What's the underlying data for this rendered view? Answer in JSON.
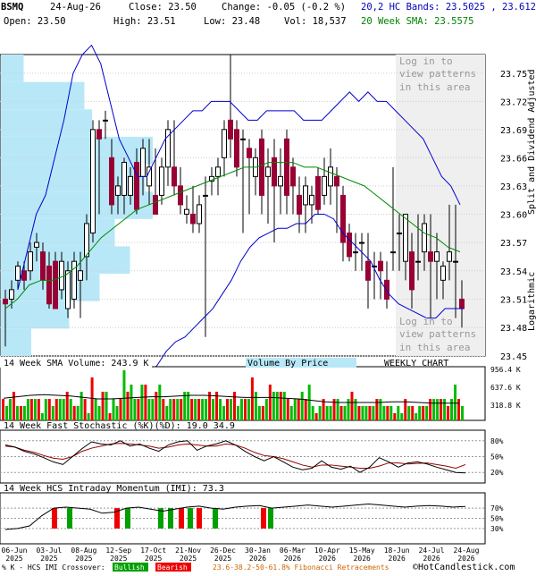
{
  "header": {
    "symbol": "BSMQ",
    "date": "24-Aug-26",
    "close": "Close: 23.50",
    "change": "Change: -0.05 (-0.2 %)",
    "open": "Open: 23.50",
    "high": "High: 23.51",
    "low": "Low: 23.48",
    "vol": "Vol: 18,537",
    "bands": "20,2 HC Bands: 23.5025 , 23.6126",
    "sma": "20 Week SMA: 23.5575"
  },
  "labels": {
    "side_adjusted": "Split and Dividend Adjusted",
    "side_log": "Logarithmic",
    "login_top": [
      "Log in to",
      "view patterns",
      "in this area"
    ],
    "login_bottom": [
      "Log in to",
      "view patterns",
      "in this area"
    ],
    "volume_title": "14 Week SMA Volume: 243.9 K",
    "vbp": "Volume By Price",
    "weekly": "WEEKLY CHART",
    "stoch_title": "14 Week Fast Stochastic (%K)(%D): 19.0  34.9",
    "imi_title": "14 Week HCS Intraday Momentum (IMI): 73.3",
    "footer_left": "% K - HCS IMI Crossover:",
    "bullish": "Bullish",
    "bearish": "Bearish",
    "fib": "23.6-38.2-50-61.8% Fibonacci Retracements",
    "copyright": "©HotCandlestick.com"
  },
  "colors": {
    "up": "#00a000",
    "down": "#990033",
    "bands": "#0000cc",
    "sma": "#008800",
    "vbp": "#b8e8f8",
    "vol_up": "#00bb00",
    "vol_down": "#ee0000",
    "bull": "#00a000",
    "bear": "#ee0000"
  },
  "chart_data": [
    {
      "type": "candlestick",
      "yscale": "log",
      "ylim": [
        23.45,
        23.77
      ],
      "ticks": [
        "23.75",
        "23.72",
        "23.69",
        "23.66",
        "23.63",
        "23.60",
        "23.57",
        "23.54",
        "23.51",
        "23.48",
        "23.45"
      ],
      "x_labels": [
        "06-Jun 2025",
        "03-Jul 2025",
        "08-Aug 2025",
        "12-Sep 2025",
        "17-Oct 2025",
        "21-Nov 2025",
        "26-Dec 2025",
        "30-Jan 2026",
        "06-Mar 2026",
        "10-Apr 2026",
        "15-May 2026",
        "18-Jun 2026",
        "24-Jul 2026",
        "24-Aug 2026"
      ],
      "candles": [
        [
          23.51,
          23.52,
          23.46,
          23.505
        ],
        [
          23.51,
          23.53,
          23.5,
          23.52
        ],
        [
          23.53,
          23.55,
          23.52,
          23.545
        ],
        [
          23.54,
          23.55,
          23.52,
          23.53
        ],
        [
          23.54,
          23.57,
          23.53,
          23.56
        ],
        [
          23.565,
          23.58,
          23.55,
          23.57
        ],
        [
          23.56,
          23.57,
          23.52,
          23.53
        ],
        [
          23.545,
          23.56,
          23.5,
          23.505
        ],
        [
          23.55,
          23.56,
          23.5,
          23.5
        ],
        [
          23.52,
          23.56,
          23.51,
          23.55
        ],
        [
          23.5,
          23.55,
          23.49,
          23.54
        ],
        [
          23.51,
          23.56,
          23.5,
          23.55
        ],
        [
          23.53,
          23.56,
          23.49,
          23.54
        ],
        [
          23.555,
          23.6,
          23.53,
          23.59
        ],
        [
          23.58,
          23.7,
          23.57,
          23.69
        ],
        [
          23.69,
          23.7,
          23.6,
          23.68
        ],
        [
          23.7,
          23.71,
          23.68,
          23.7
        ],
        [
          23.66,
          23.68,
          23.6,
          23.61
        ],
        [
          23.62,
          23.64,
          23.6,
          23.63
        ],
        [
          23.62,
          23.66,
          23.6,
          23.655
        ],
        [
          23.62,
          23.65,
          23.61,
          23.64
        ],
        [
          23.655,
          23.67,
          23.6,
          23.605
        ],
        [
          23.64,
          23.68,
          23.62,
          23.67
        ],
        [
          23.63,
          23.68,
          23.61,
          23.65
        ],
        [
          23.62,
          23.67,
          23.6,
          23.6
        ],
        [
          23.62,
          23.66,
          23.61,
          23.65
        ],
        [
          23.65,
          23.7,
          23.63,
          23.69
        ],
        [
          23.65,
          23.7,
          23.62,
          23.63
        ],
        [
          23.63,
          23.65,
          23.6,
          23.61
        ],
        [
          23.6,
          23.62,
          23.59,
          23.605
        ],
        [
          23.6,
          23.63,
          23.58,
          23.59
        ],
        [
          23.59,
          23.62,
          23.58,
          23.61
        ],
        [
          23.62,
          23.64,
          23.47,
          23.62
        ],
        [
          23.635,
          23.65,
          23.62,
          23.64
        ],
        [
          23.64,
          23.66,
          23.62,
          23.65
        ],
        [
          23.66,
          23.7,
          23.64,
          23.69
        ],
        [
          23.7,
          23.77,
          23.66,
          23.68
        ],
        [
          23.69,
          23.7,
          23.64,
          23.65
        ],
        [
          23.68,
          23.69,
          23.58,
          23.68
        ],
        [
          23.67,
          23.68,
          23.6,
          23.66
        ],
        [
          23.64,
          23.67,
          23.62,
          23.66
        ],
        [
          23.68,
          23.69,
          23.6,
          23.62
        ],
        [
          23.64,
          23.67,
          23.59,
          23.65
        ],
        [
          23.66,
          23.68,
          23.57,
          23.63
        ],
        [
          23.63,
          23.67,
          23.6,
          23.64
        ],
        [
          23.68,
          23.69,
          23.6,
          23.62
        ],
        [
          23.65,
          23.66,
          23.6,
          23.63
        ],
        [
          23.62,
          23.64,
          23.58,
          23.6
        ],
        [
          23.61,
          23.64,
          23.58,
          23.63
        ],
        [
          23.61,
          23.63,
          23.59,
          23.62
        ],
        [
          23.64,
          23.65,
          23.6,
          23.605
        ],
        [
          23.62,
          23.66,
          23.61,
          23.64
        ],
        [
          23.63,
          23.67,
          23.61,
          23.65
        ],
        [
          23.64,
          23.65,
          23.58,
          23.63
        ],
        [
          23.62,
          23.63,
          23.55,
          23.57
        ],
        [
          23.58,
          23.59,
          23.55,
          23.555
        ],
        [
          23.56,
          23.58,
          23.54,
          23.56
        ],
        [
          23.57,
          23.58,
          23.54,
          23.57
        ],
        [
          23.55,
          23.58,
          23.5,
          23.53
        ],
        [
          23.545,
          23.56,
          23.51,
          23.545
        ],
        [
          23.55,
          23.56,
          23.51,
          23.54
        ],
        [
          23.53,
          23.55,
          23.5,
          23.51
        ],
        [
          23.56,
          23.65,
          23.54,
          23.56
        ],
        [
          23.58,
          23.6,
          23.54,
          23.58
        ],
        [
          23.55,
          23.6,
          23.53,
          23.6
        ],
        [
          23.56,
          23.58,
          23.5,
          23.52
        ],
        [
          23.55,
          23.6,
          23.53,
          23.55
        ],
        [
          23.56,
          23.6,
          23.54,
          23.59
        ],
        [
          23.56,
          23.6,
          23.49,
          23.55
        ],
        [
          23.55,
          23.58,
          23.51,
          23.56
        ],
        [
          23.53,
          23.55,
          23.51,
          23.545
        ],
        [
          23.55,
          23.61,
          23.53,
          23.56
        ],
        [
          23.55,
          23.61,
          23.49,
          23.55
        ],
        [
          23.51,
          23.53,
          23.48,
          23.5
        ]
      ],
      "upper_band": [
        23.52,
        23.56,
        23.6,
        23.62,
        23.66,
        23.7,
        23.75,
        23.77,
        23.78,
        23.76,
        23.72,
        23.68,
        23.66,
        23.64,
        23.64,
        23.66,
        23.68,
        23.69,
        23.7,
        23.71,
        23.71,
        23.72,
        23.72,
        23.72,
        23.71,
        23.7,
        23.7,
        23.71,
        23.71,
        23.71,
        23.71,
        23.7,
        23.7,
        23.7,
        23.71,
        23.72,
        23.73,
        23.72,
        23.73,
        23.72,
        23.72,
        23.71,
        23.7,
        23.69,
        23.68,
        23.66,
        23.64,
        23.63,
        23.61
      ],
      "lower_band": [
        23.42,
        23.43,
        23.44,
        23.455,
        23.465,
        23.47,
        23.48,
        23.49,
        23.5,
        23.515,
        23.53,
        23.55,
        23.565,
        23.575,
        23.58,
        23.585,
        23.585,
        23.59,
        23.59,
        23.6,
        23.6,
        23.595,
        23.58,
        23.57,
        23.56,
        23.55,
        23.53,
        23.515,
        23.505,
        23.5,
        23.495,
        23.49,
        23.49,
        23.5,
        23.5,
        23.5
      ],
      "sma20": [
        23.5,
        23.51,
        23.525,
        23.53,
        23.53,
        23.535,
        23.545,
        23.56,
        23.575,
        23.585,
        23.595,
        23.605,
        23.61,
        23.615,
        23.62,
        23.625,
        23.63,
        23.635,
        23.64,
        23.645,
        23.65,
        23.65,
        23.655,
        23.655,
        23.655,
        23.65,
        23.65,
        23.645,
        23.64,
        23.635,
        23.63,
        23.62,
        23.61,
        23.6,
        23.59,
        23.58,
        23.575,
        23.565,
        23.56
      ],
      "volume_by_price": [
        0.15,
        0.55,
        0.6,
        1.0,
        0.95,
        1.0,
        0.75,
        0.85,
        0.65,
        0.45,
        0.2
      ]
    },
    {
      "type": "bar",
      "name": "volume",
      "ticks": [
        "956.4 K",
        "637.6 K",
        "318.8 K"
      ],
      "values": [
        3,
        2,
        3,
        4,
        2,
        2,
        2,
        3,
        3,
        3,
        3,
        1,
        3,
        3,
        2,
        3,
        3,
        3,
        4,
        3,
        2,
        2,
        4,
        3,
        1,
        6,
        3,
        2,
        4,
        4,
        1,
        3,
        2,
        3,
        7,
        4,
        5,
        3,
        3,
        5,
        5,
        3,
        3,
        4,
        5,
        3,
        2,
        3,
        3,
        3,
        3,
        4,
        4,
        3,
        3,
        3,
        3,
        3,
        4,
        3,
        4,
        3,
        2,
        3,
        3,
        4,
        2,
        3,
        3,
        3,
        6,
        4,
        2,
        2,
        3,
        5,
        4,
        4,
        4,
        4,
        3,
        2,
        3,
        3,
        4,
        3,
        5,
        2,
        1,
        2,
        3,
        2,
        2,
        3,
        3,
        2,
        2,
        3,
        4,
        3,
        2,
        2,
        2,
        2,
        2,
        3,
        3,
        2,
        2,
        2,
        1,
        2,
        1,
        3,
        2,
        2,
        1,
        2,
        2,
        2,
        3,
        3,
        3,
        3,
        3,
        2,
        3,
        5,
        3,
        2
      ],
      "sma": [
        3.1,
        3.3,
        3.5,
        3.6,
        3.5,
        3.4,
        3.2,
        3.0,
        3.0,
        3.1,
        3.2,
        3.3,
        3.3,
        3.4,
        3.5,
        3.5,
        3.4,
        3.3,
        3.2,
        3.2,
        3.2,
        3.1,
        3.0,
        2.8,
        2.6,
        2.5,
        2.5,
        2.5,
        2.5,
        2.6,
        2.6,
        2.5,
        2.4,
        2.4,
        2.4
      ]
    },
    {
      "type": "line",
      "name": "stochastic",
      "ticks": [
        "80%",
        "50%",
        "20%"
      ],
      "k": [
        72,
        68,
        60,
        55,
        48,
        40,
        35,
        50,
        65,
        78,
        74,
        72,
        80,
        70,
        74,
        66,
        60,
        72,
        78,
        80,
        62,
        70,
        74,
        80,
        72,
        60,
        50,
        42,
        50,
        40,
        30,
        25,
        28,
        42,
        30,
        26,
        32,
        20,
        30,
        48,
        40,
        30,
        38,
        40,
        36,
        30,
        25,
        20,
        19
      ],
      "d": [
        70,
        68,
        62,
        58,
        52,
        47,
        45,
        50,
        60,
        66,
        70,
        74,
        75,
        74,
        72,
        70,
        66,
        68,
        72,
        74,
        72,
        70,
        70,
        74,
        72,
        66,
        58,
        52,
        50,
        46,
        40,
        34,
        30,
        34,
        34,
        32,
        30,
        28,
        28,
        32,
        38,
        38,
        36,
        37,
        38,
        35,
        32,
        28,
        34.9
      ]
    },
    {
      "type": "line",
      "name": "imi",
      "ticks": [
        "70%",
        "50%",
        "30%"
      ],
      "values": [
        28,
        30,
        35,
        55,
        70,
        72,
        70,
        68,
        60,
        62,
        70,
        72,
        68,
        64,
        68,
        72,
        74,
        70,
        68,
        72,
        74,
        75,
        70,
        72,
        74,
        76,
        74,
        72,
        74,
        76,
        78,
        76,
        74,
        72,
        74,
        75,
        74,
        72,
        73.3
      ],
      "crossovers": [
        "bear",
        "bull",
        "bear",
        "bull",
        "bull",
        "bull",
        "bear",
        "bull",
        "bear",
        "bull",
        "bear",
        "bull",
        "bear",
        "bear",
        "bull",
        "bear"
      ]
    }
  ]
}
